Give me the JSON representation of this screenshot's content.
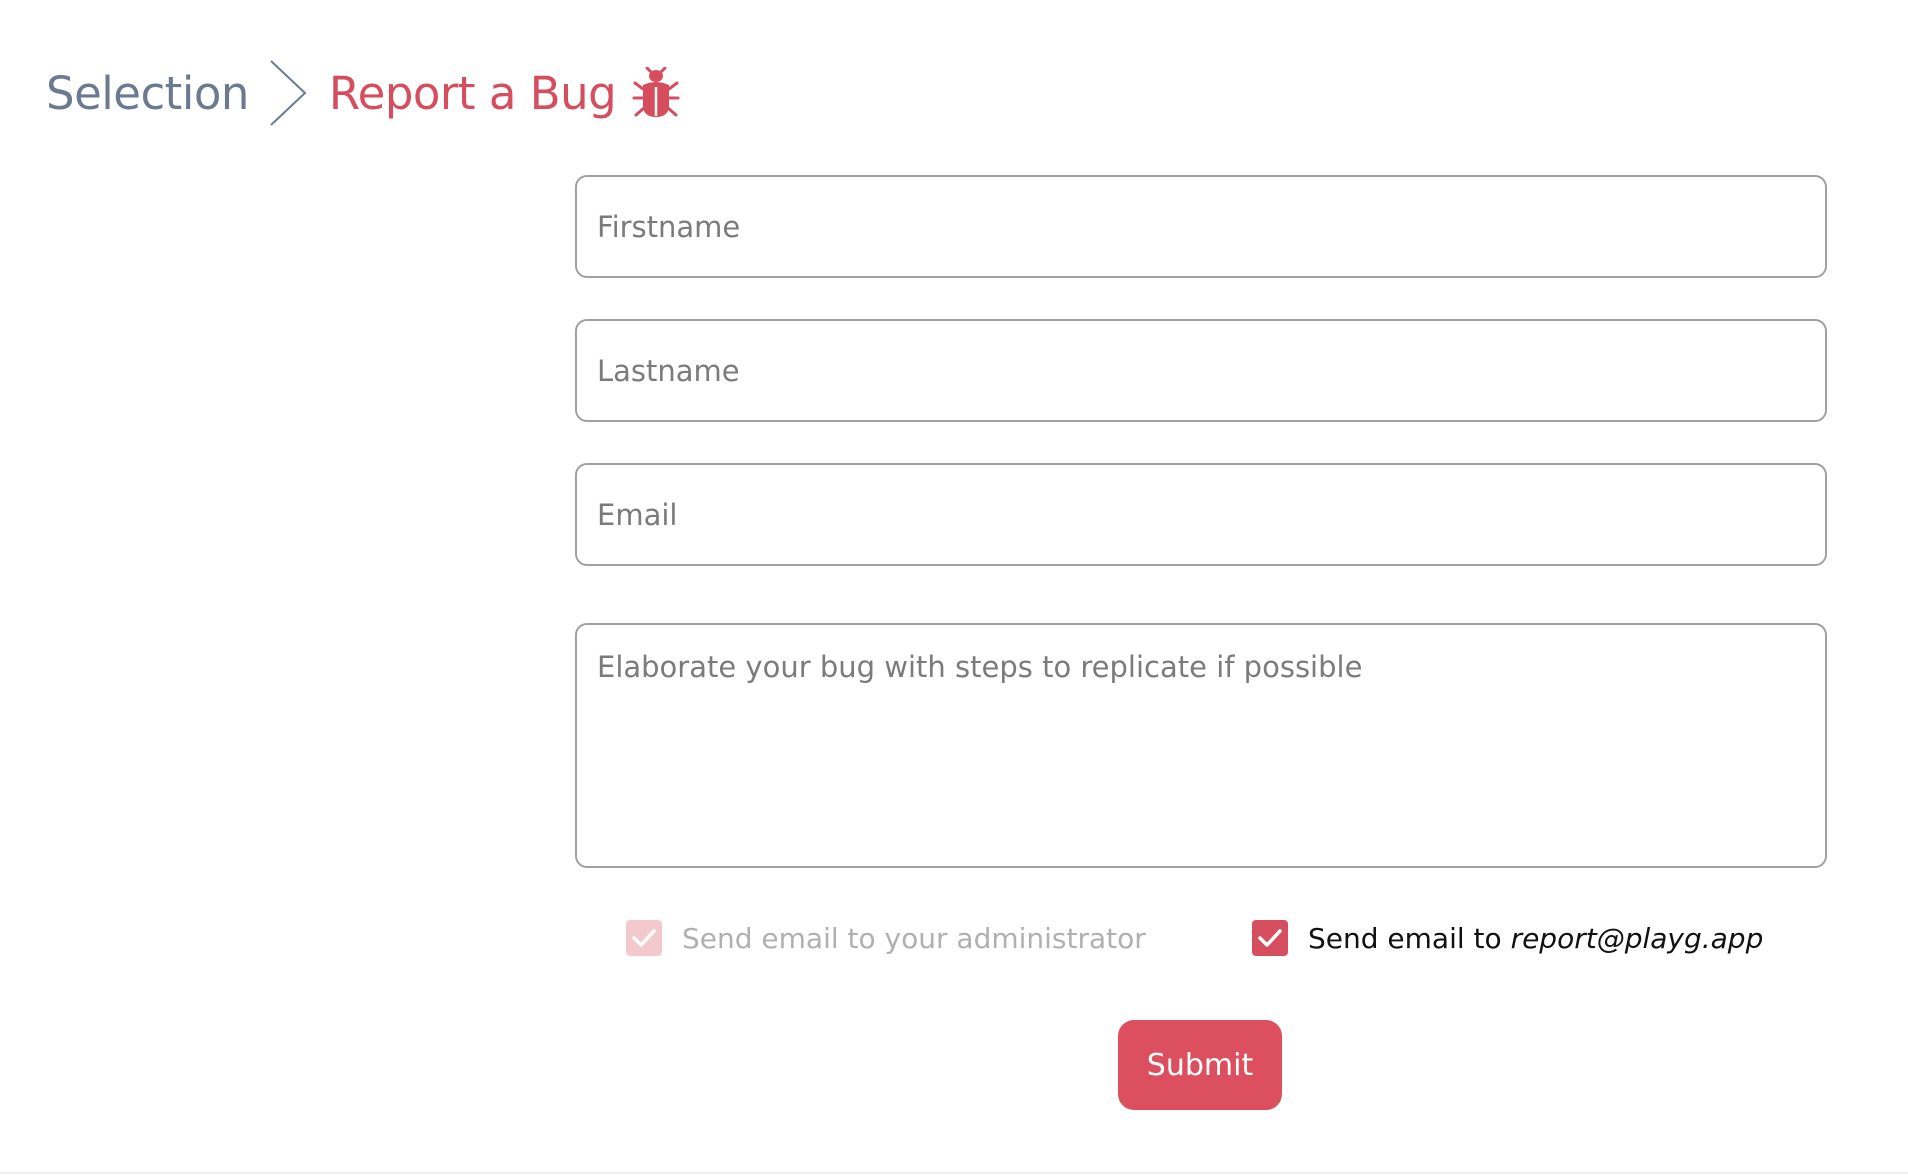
{
  "breadcrumb": {
    "parent_label": "Selection",
    "current_label": "Report a Bug",
    "separator_icon": "chevron-right-icon",
    "current_icon": "bug-icon"
  },
  "form": {
    "firstname": {
      "placeholder": "Firstname",
      "value": ""
    },
    "lastname": {
      "placeholder": "Lastname",
      "value": ""
    },
    "email": {
      "placeholder": "Email",
      "value": ""
    },
    "description": {
      "placeholder": "Elaborate your bug with steps to replicate if possible",
      "value": ""
    },
    "send_admin": {
      "label": "Send email to your administrator",
      "checked": true,
      "disabled": true
    },
    "send_report": {
      "label_prefix": "Send email to ",
      "label_email": "report@playg.app",
      "checked": true,
      "disabled": false
    },
    "submit_label": "Submit"
  },
  "colors": {
    "accent": "#dc4f5e",
    "accent_disabled": "#f4c9ce",
    "breadcrumb_parent": "#6c7a91",
    "field_border": "#a0a0a0"
  }
}
